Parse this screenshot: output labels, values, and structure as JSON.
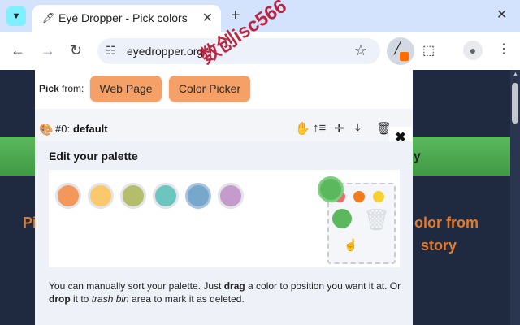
{
  "browser": {
    "tab": {
      "title": "Eye Dropper - Pick colors",
      "favicon": "eyedropper-icon"
    },
    "url": "eyedropper.org"
  },
  "background": {
    "band_text": "cy",
    "left_text": "Pi",
    "right_text_1": "olor from",
    "right_text_2": "story"
  },
  "popup": {
    "pick_label_bold": "Pick",
    "pick_label_rest": " from:",
    "buttons": {
      "web_page": "Web Page",
      "color_picker": "Color Picker"
    },
    "palette": {
      "number": "#0:",
      "name": "default"
    },
    "edit_title": "Edit your palette",
    "swatches": [
      {
        "color": "#f4975a",
        "selected": false
      },
      {
        "color": "#f9c96b",
        "selected": false
      },
      {
        "color": "#b3bd6b",
        "selected": false
      },
      {
        "color": "#6cc5be",
        "selected": false
      },
      {
        "color": "#78a7cc",
        "selected": true
      },
      {
        "color": "#c49bcb",
        "selected": false
      }
    ],
    "trash_zone_dots": [
      "#ef6a6a",
      "#f57a1c",
      "#f7d033"
    ],
    "drag_color": "#5cb85c",
    "help": {
      "p1": "You can manually sort your palette. Just ",
      "drag": "drag",
      "p2": " a color to position you want it at. Or ",
      "drop": "drop",
      "p3": " it to ",
      "trash_bin": "trash bin",
      "p4": " area to mark it as deleted."
    }
  },
  "watermark": "数创isc566"
}
